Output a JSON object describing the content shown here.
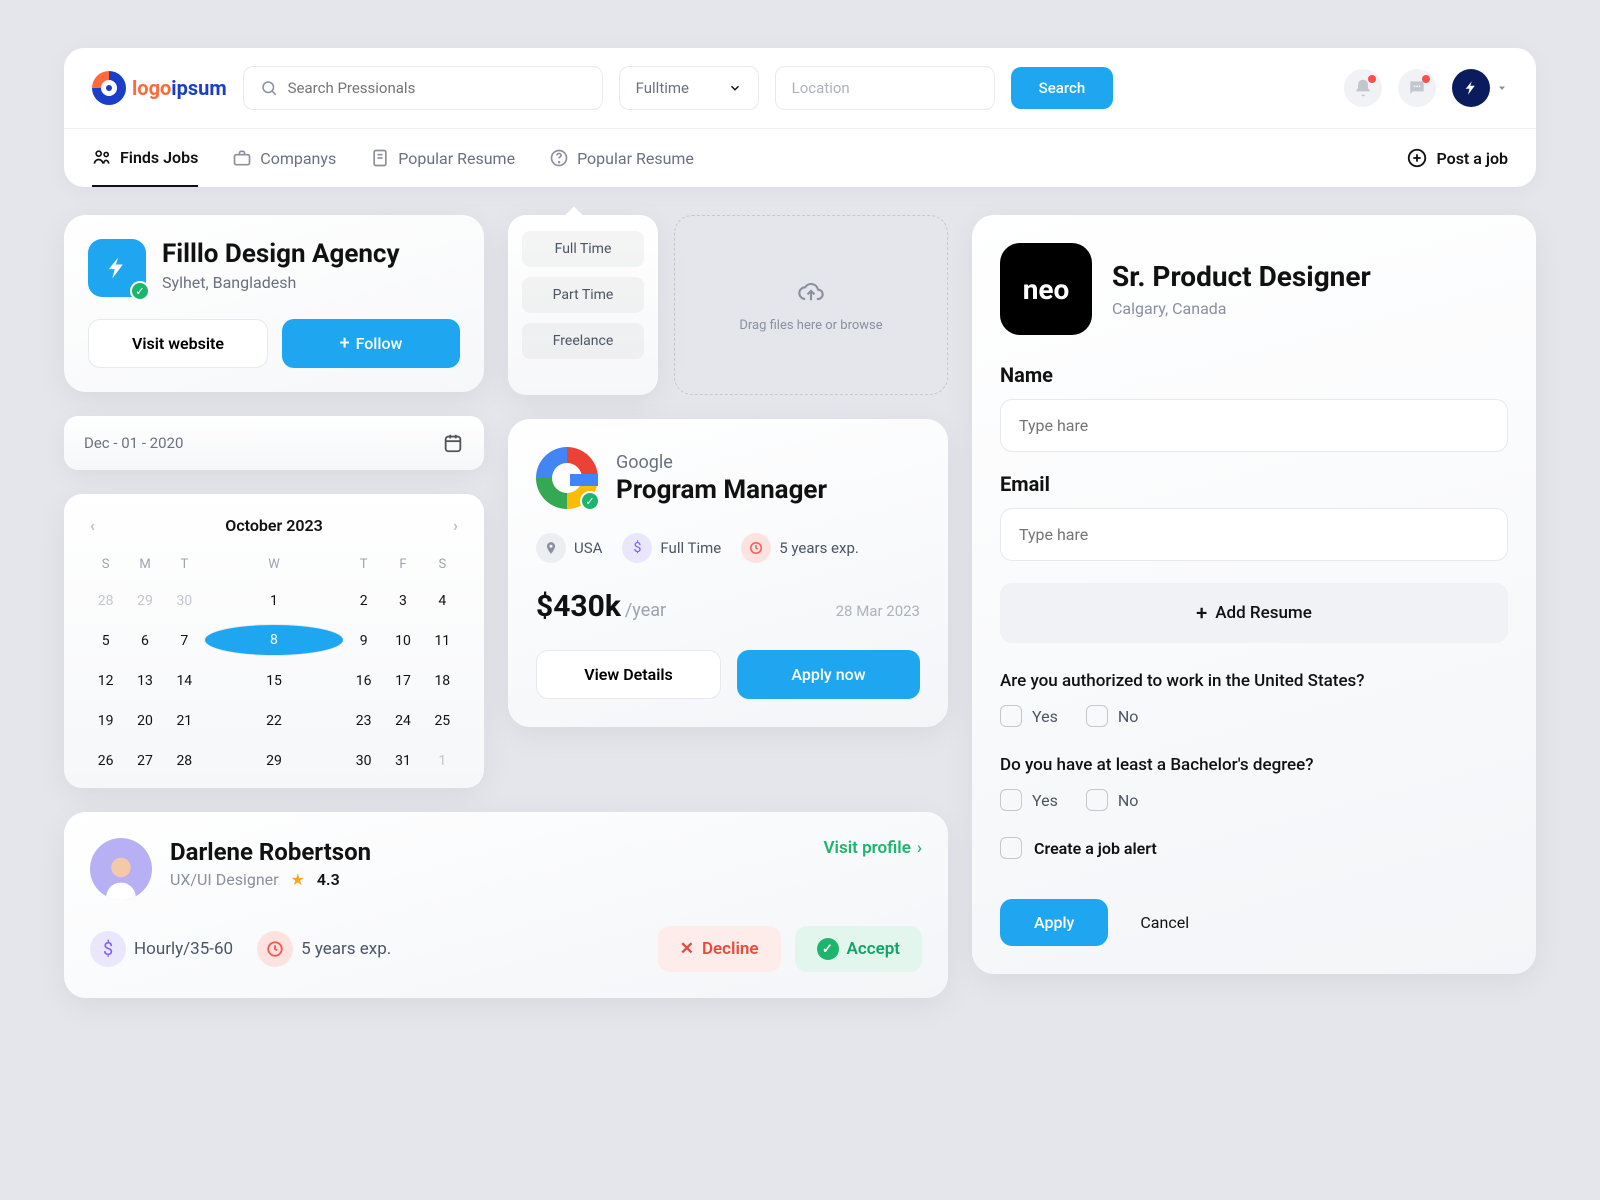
{
  "header": {
    "logo1": "logo",
    "logo2": "ipsum",
    "search_placeholder": "Search Pressionals",
    "fulltime": "Fulltime",
    "location_placeholder": "Location",
    "search_btn": "Search"
  },
  "nav": {
    "find": "Finds Jobs",
    "companys": "Companys",
    "popular1": "Popular Resume",
    "popular2": "Popular Resume",
    "post": "Post a job"
  },
  "agency": {
    "name": "Filllo Design Agency",
    "location": "Sylhet, Bangladesh",
    "visit": "Visit website",
    "follow": "Follow"
  },
  "chips": {
    "c1": "Full Time",
    "c2": "Part Time",
    "c3": "Freelance"
  },
  "upload": "Drag files here or browse",
  "date": "Dec - 01 - 2020",
  "calendar": {
    "title": "October 2023",
    "dow": [
      "S",
      "M",
      "T",
      "W",
      "T",
      "F",
      "S"
    ],
    "days": [
      {
        "n": 28,
        "dim": true
      },
      {
        "n": 29,
        "dim": true
      },
      {
        "n": 30,
        "dim": true
      },
      {
        "n": 1
      },
      {
        "n": 2
      },
      {
        "n": 3
      },
      {
        "n": 4
      },
      {
        "n": 5
      },
      {
        "n": 6
      },
      {
        "n": 7
      },
      {
        "n": 8,
        "sel": true
      },
      {
        "n": 9
      },
      {
        "n": 10
      },
      {
        "n": 11
      },
      {
        "n": 12
      },
      {
        "n": 13
      },
      {
        "n": 14
      },
      {
        "n": 15
      },
      {
        "n": 16
      },
      {
        "n": 17
      },
      {
        "n": 18
      },
      {
        "n": 19
      },
      {
        "n": 20
      },
      {
        "n": 21
      },
      {
        "n": 22
      },
      {
        "n": 23
      },
      {
        "n": 24
      },
      {
        "n": 25
      },
      {
        "n": 26
      },
      {
        "n": 27
      },
      {
        "n": 28
      },
      {
        "n": 29
      },
      {
        "n": 30
      },
      {
        "n": 31
      },
      {
        "n": 1,
        "dim": true
      }
    ]
  },
  "job": {
    "company": "Google",
    "title": "Program Manager",
    "location": "USA",
    "type": "Full Time",
    "exp": "5 years exp.",
    "salary": "$430k",
    "period": "/year",
    "date": "28 Mar 2023",
    "details": "View Details",
    "apply": "Apply now"
  },
  "profile": {
    "name": "Darlene Robertson",
    "role": "UX/UI Designer",
    "rating": "4.3",
    "visit": "Visit profile",
    "rate": "Hourly/35-60",
    "exp": "5 years exp.",
    "decline": "Decline",
    "accept": "Accept"
  },
  "form": {
    "brand": "neo",
    "title": "Sr. Product Designer",
    "location": "Calgary, Canada",
    "name_label": "Name",
    "name_ph": "Type hare",
    "email_label": "Email",
    "email_ph": "Type hare",
    "add_resume": "Add Resume",
    "q1": "Are you authorized to work in the United States?",
    "q2": "Do you have at least a Bachelor's degree?",
    "yes": "Yes",
    "no": "No",
    "alert": "Create a job alert",
    "apply": "Apply",
    "cancel": "Cancel"
  }
}
